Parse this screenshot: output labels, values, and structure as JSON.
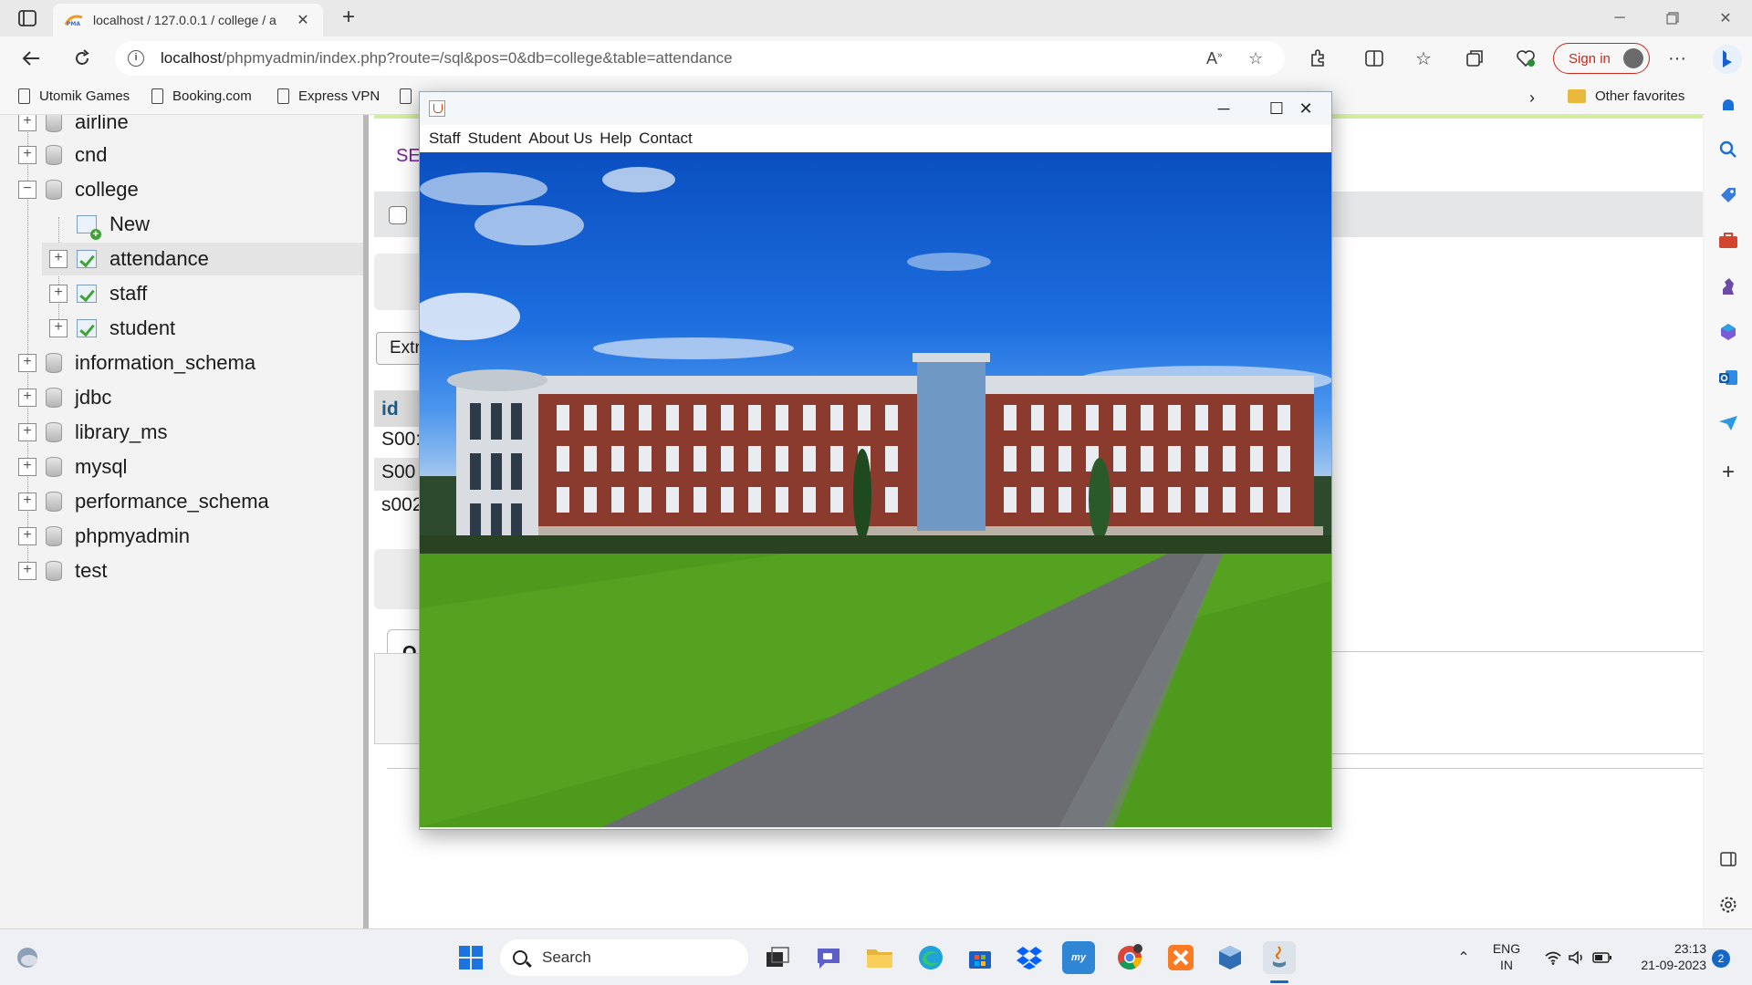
{
  "browser": {
    "tab_title": "localhost / 127.0.0.1 / college / a",
    "address_host": "localhost",
    "address_path": "/phpmyadmin/index.php?route=/sql&pos=0&db=college&table=attendance",
    "signin_label": "Sign in",
    "favorites": [
      "Utomik Games",
      "Booking.com",
      "Express VPN"
    ],
    "other_favorites": "Other favorites"
  },
  "navigation": {
    "databases": [
      {
        "name": "airline",
        "expanded": false
      },
      {
        "name": "cnd",
        "expanded": false
      },
      {
        "name": "college",
        "expanded": true
      },
      {
        "name": "information_schema",
        "expanded": false
      },
      {
        "name": "jdbc",
        "expanded": false
      },
      {
        "name": "library_ms",
        "expanded": false
      },
      {
        "name": "mysql",
        "expanded": false
      },
      {
        "name": "performance_schema",
        "expanded": false
      },
      {
        "name": "phpmyadmin",
        "expanded": false
      },
      {
        "name": "test",
        "expanded": false
      }
    ],
    "college_children": [
      "New",
      "attendance",
      "staff",
      "student"
    ]
  },
  "main": {
    "section_label": "SE",
    "extra_label": "Extr",
    "col_header": "id",
    "cells": [
      "S00:",
      "S00",
      "s002"
    ],
    "query_label": "Q"
  },
  "java_window": {
    "menu": [
      "Staff",
      "Student",
      "About Us",
      "Help",
      "Contact"
    ]
  },
  "taskbar": {
    "search_placeholder": "Search",
    "lang_1": "ENG",
    "lang_2": "IN",
    "time": "23:13",
    "date": "21-09-2023",
    "notification_count": "2"
  }
}
